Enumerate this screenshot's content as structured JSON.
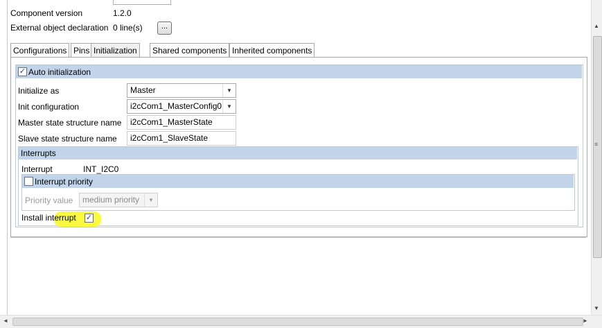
{
  "header": {
    "component_version_label": "Component version",
    "component_version_value": "1.2.0",
    "external_decl_label": "External object declaration",
    "external_decl_value": "0 line(s)",
    "dots_button_label": "..."
  },
  "tabs": [
    {
      "label": "Configurations",
      "active": false
    },
    {
      "label": "Pins",
      "active": false
    },
    {
      "label": "Initialization",
      "active": true
    },
    {
      "label": "Shared components",
      "active": false
    },
    {
      "label": "Inherited components",
      "active": false
    }
  ],
  "init": {
    "auto_init_label": "Auto initialization",
    "auto_init_checked": true,
    "initialize_as_label": "Initialize as",
    "initialize_as_value": "Master",
    "init_config_label": "Init configuration",
    "init_config_value": "i2cCom1_MasterConfig0",
    "master_state_label": "Master state structure name",
    "master_state_value": "i2cCom1_MasterState",
    "slave_state_label": "Slave state structure name",
    "slave_state_value": "i2cCom1_SlaveState"
  },
  "interrupts": {
    "group_label": "Interrupts",
    "interrupt_label": "Interrupt",
    "interrupt_value": "INT_I2C0",
    "priority_group_label": "Interrupt priority",
    "priority_checked": false,
    "priority_value_label": "Priority value",
    "priority_value": "medium priority",
    "install_label": "Install interrupt",
    "install_checked": true
  },
  "colors": {
    "group_header": "#c1d4ea",
    "highlight": "#f8f940"
  },
  "icons": {
    "check": "✓",
    "dropdown": "▼",
    "scroll_up": "▲",
    "scroll_down": "▼",
    "scroll_left": "◄",
    "scroll_right": "►",
    "grip": "≡"
  }
}
